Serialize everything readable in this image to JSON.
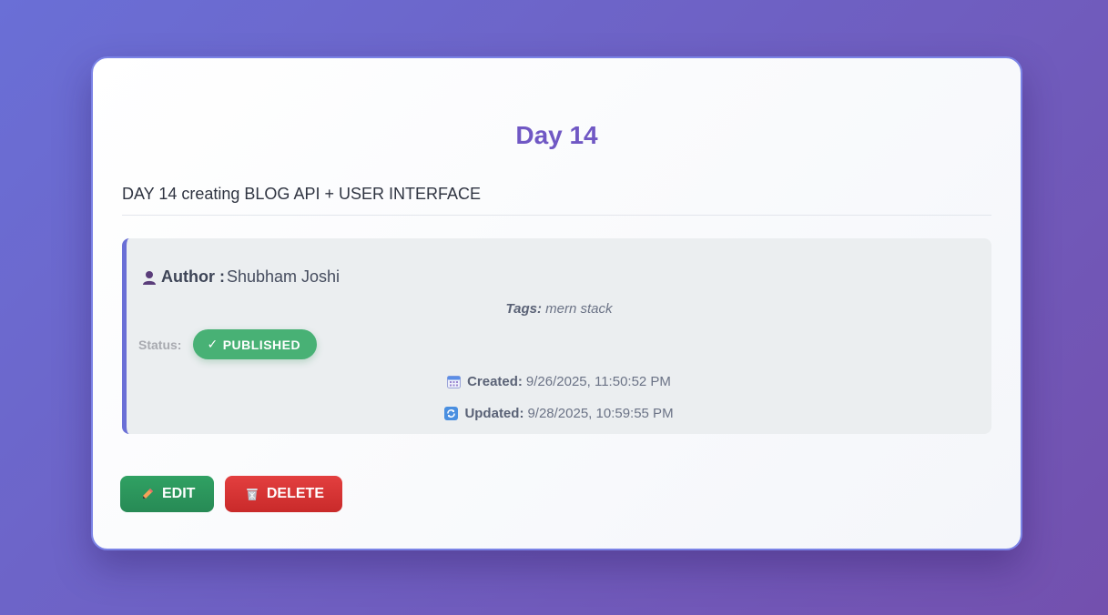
{
  "post": {
    "title": "Day 14",
    "description": "DAY 14 creating BLOG API + USER INTERFACE"
  },
  "meta": {
    "author_label": "Author :",
    "author_name": "Shubham Joshi",
    "author_icon": "user-icon",
    "tags_label": "Tags:",
    "tags_value": "mern stack",
    "status_label": "Status:",
    "status_check": "✓",
    "status_value": "PUBLISHED",
    "status_color": "#48b175",
    "created_label": "Created:",
    "created_value": "9/26/2025, 11:50:52 PM",
    "created_icon": "calendar-icon",
    "updated_label": "Updated:",
    "updated_value": "9/28/2025, 10:59:55 PM",
    "updated_icon": "refresh-icon"
  },
  "actions": {
    "edit_label": "EDIT",
    "edit_icon": "pencil-icon",
    "edit_color": "#2f9a5e",
    "delete_label": "DELETE",
    "delete_icon": "trash-icon",
    "delete_color": "#dc3636"
  },
  "theme": {
    "accent": "#7058c4",
    "background_start": "#6a6fd6",
    "background_end": "#7350ae"
  }
}
